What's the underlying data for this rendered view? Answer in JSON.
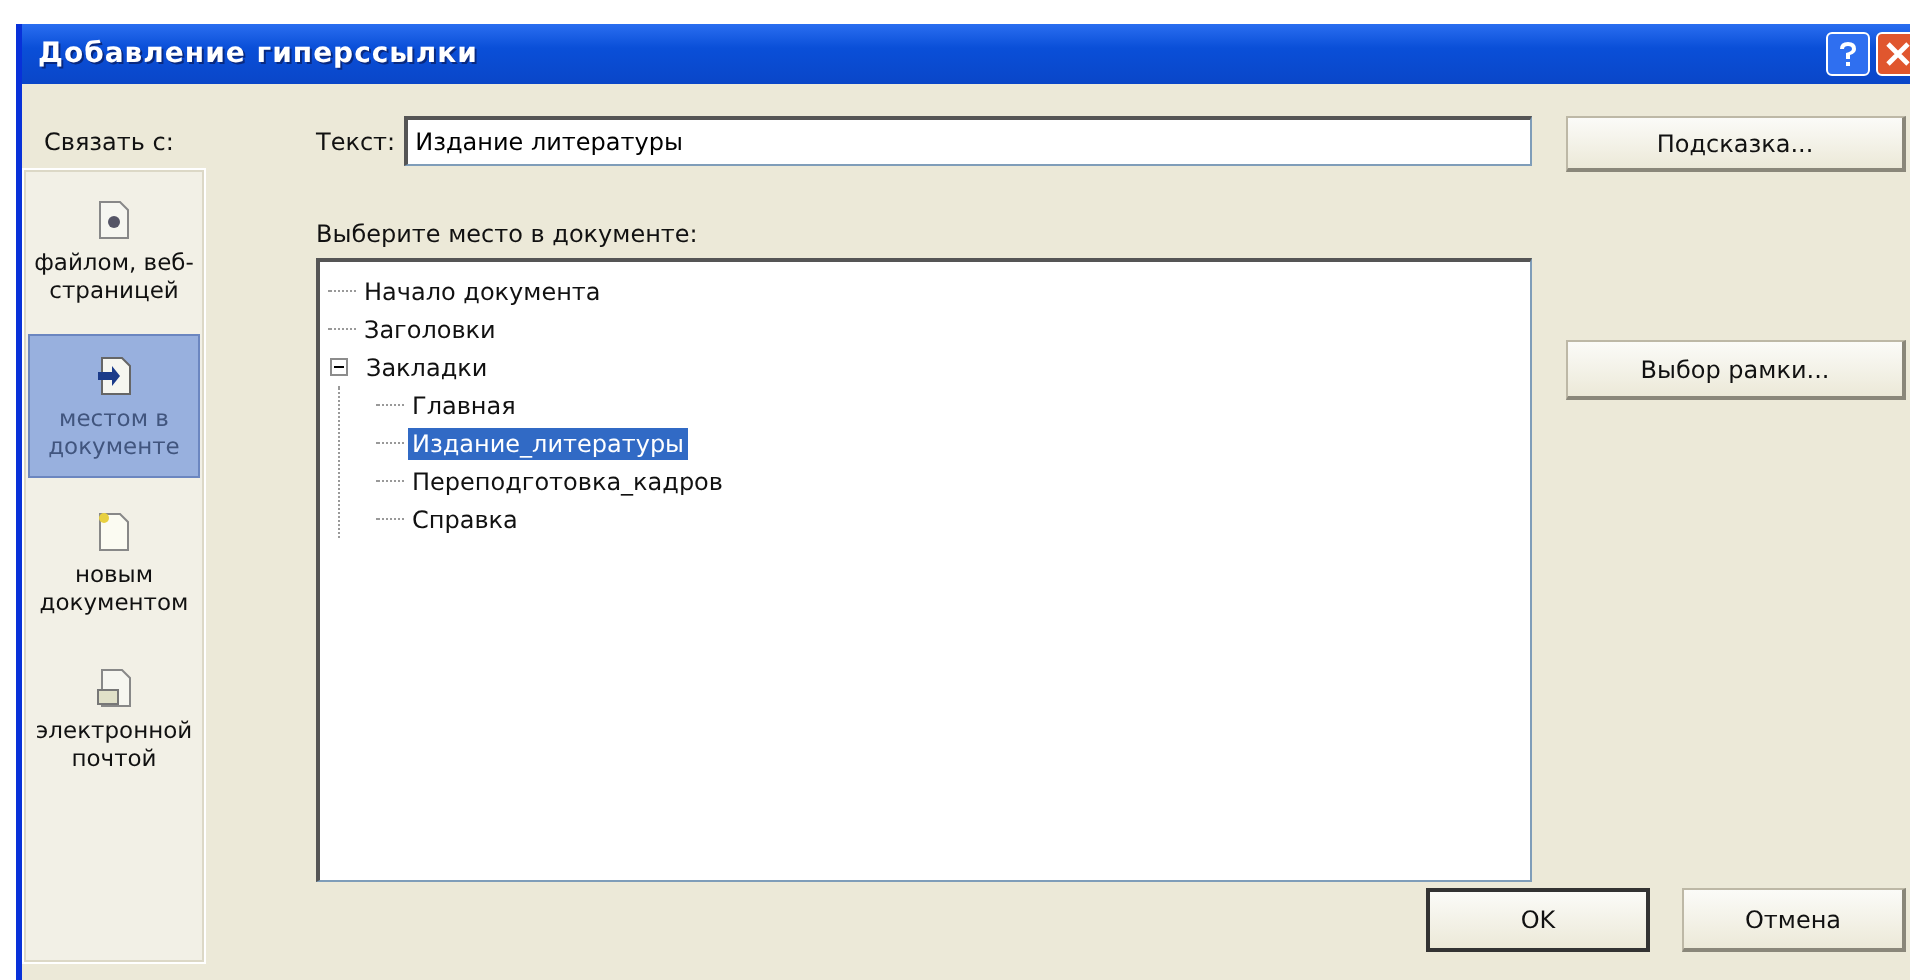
{
  "window": {
    "title": "Добавление гиперссылки"
  },
  "link_to": {
    "label": "Связать с:",
    "items": [
      {
        "label": "файлом, веб-страницей",
        "kind": "file",
        "selected": false
      },
      {
        "label": "местом в документе",
        "kind": "place",
        "selected": true
      },
      {
        "label": "новым документом",
        "kind": "new",
        "selected": false
      },
      {
        "label": "электронной почтой",
        "kind": "mail",
        "selected": false
      }
    ]
  },
  "text_field": {
    "label": "Текст:",
    "value": "Издание литературы"
  },
  "hint_button": "Подсказка...",
  "place": {
    "label": "Выберите место в документе:",
    "tree": [
      {
        "label": "Начало документа",
        "selected": false
      },
      {
        "label": "Заголовки",
        "selected": false
      },
      {
        "label": "Закладки",
        "selected": false,
        "expanded": true,
        "children": [
          {
            "label": "Главная",
            "selected": false
          },
          {
            "label": "Издание_литературы",
            "selected": true
          },
          {
            "label": "Переподготовка_кадров",
            "selected": false
          },
          {
            "label": "Справка",
            "selected": false
          }
        ]
      }
    ]
  },
  "frame_button": "Выбор рамки...",
  "buttons": [
    {
      "label": "OK",
      "default": true
    },
    {
      "label": "Отмена",
      "default": false
    }
  ]
}
